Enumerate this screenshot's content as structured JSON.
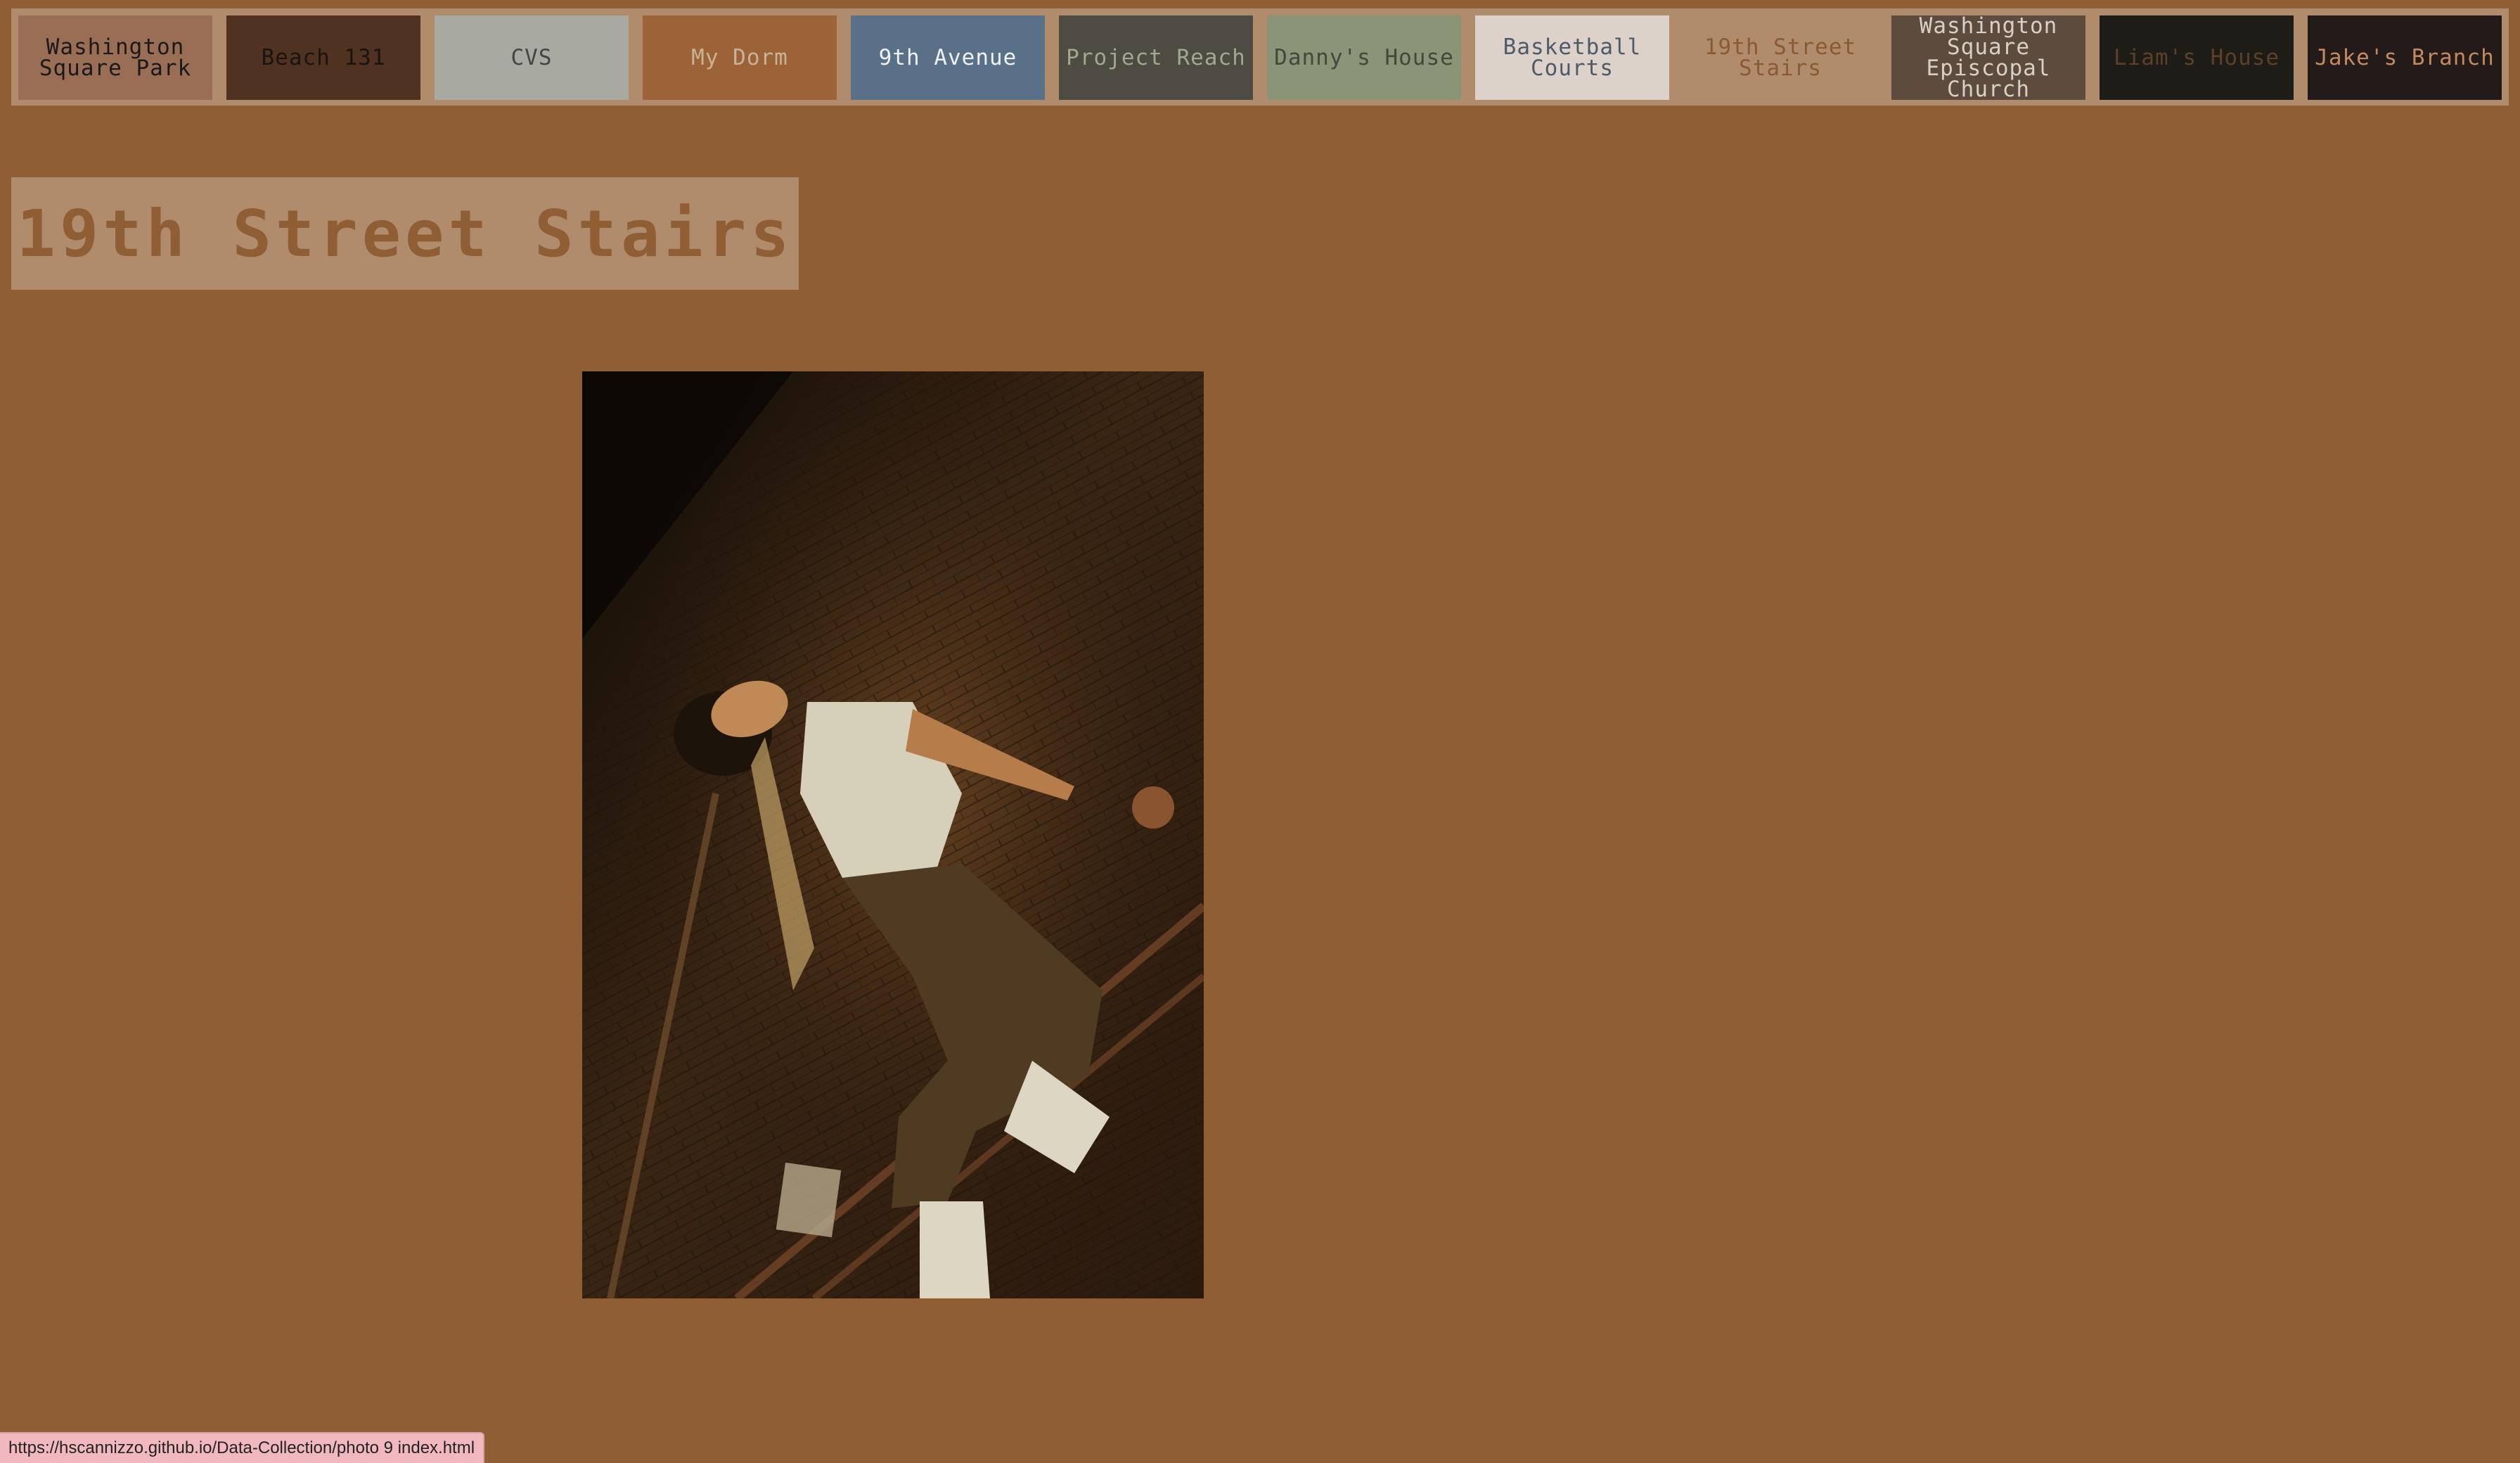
{
  "nav": {
    "items": [
      {
        "label": "Washington\nSquare Park",
        "bg": "#9a6e55",
        "color": "#1a1a1a"
      },
      {
        "label": "Beach 131",
        "bg": "#4f3220",
        "color": "#1a1410"
      },
      {
        "label": "CVS",
        "bg": "#a8aaa2",
        "color": "#444444"
      },
      {
        "label": "My Dorm",
        "bg": "#9b6336",
        "color": "#c8b39a"
      },
      {
        "label": "9th Avenue",
        "bg": "#587189",
        "color": "#f0f0f0"
      },
      {
        "label": "Project Reach",
        "bg": "#4d4b42",
        "color": "#a2a88e"
      },
      {
        "label": "Danny's House",
        "bg": "#8a9476",
        "color": "#3f4a3d"
      },
      {
        "label": "Basketball Courts",
        "bg": "#ddd2c9",
        "color": "#4d5a6a"
      },
      {
        "label": "19th Street\nStairs",
        "bg": "#b08c6c",
        "color": "#8a5a32"
      },
      {
        "label": "Washington\nSquare Episcopal\nChurch",
        "bg": "#5d4c3e",
        "color": "#d8d0c6"
      },
      {
        "label": "Liam's House",
        "bg": "#1e1c16",
        "color": "#5c4128"
      },
      {
        "label": "Jake's Branch",
        "bg": "#231a1a",
        "color": "#c48a5e"
      }
    ]
  },
  "page": {
    "title": "19th Street Stairs"
  },
  "photo": {
    "alt": "Person leaning back on a fire escape stairway against a brick wall"
  },
  "status_bar": {
    "url": "https://hscannizzo.github.io/Data-Collection/photo 9 index.html"
  }
}
